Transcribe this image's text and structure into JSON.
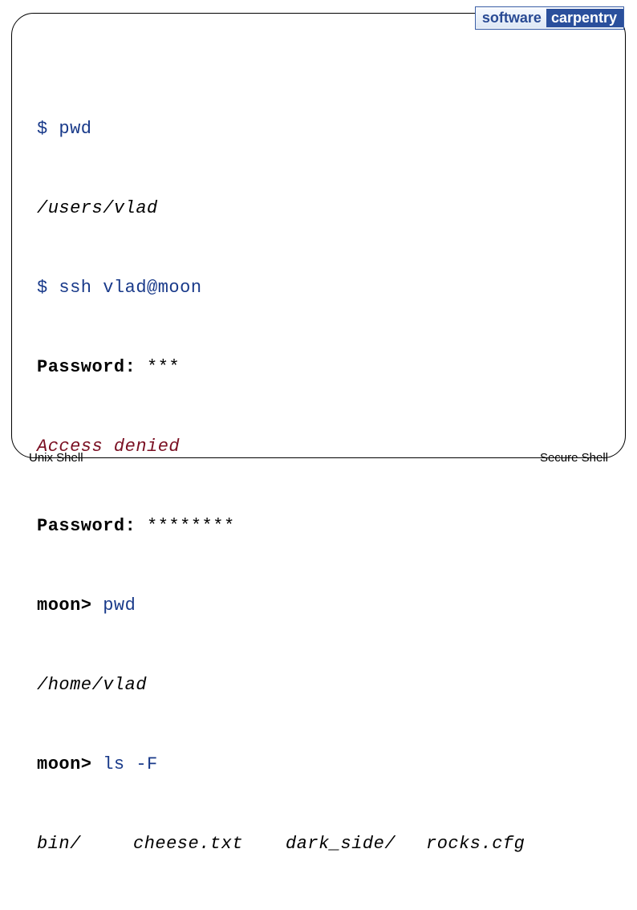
{
  "logo": {
    "left": "software",
    "right": "carpentry"
  },
  "terminal": {
    "l1": {
      "prompt": "$",
      "cmd": "pwd"
    },
    "l2": {
      "out": "/users/vlad"
    },
    "l3": {
      "prompt": "$",
      "cmd": "ssh vlad@moon"
    },
    "l4": {
      "label": "Password:",
      "masked": "***"
    },
    "l5": {
      "err": "Access denied"
    },
    "l6": {
      "label": "Password:",
      "masked": "********"
    },
    "l7": {
      "prompt": "moon>",
      "cmd": "pwd"
    },
    "l8": {
      "out": "/home/vlad"
    },
    "l9": {
      "prompt": "moon>",
      "cmd": "ls -F"
    },
    "l10": {
      "c1": "bin/",
      "c2": "cheese.txt",
      "c3": "dark_side/",
      "c4": "rocks.cfg"
    }
  },
  "footer": {
    "left": "Unix Shell",
    "right": "Secure Shell"
  }
}
